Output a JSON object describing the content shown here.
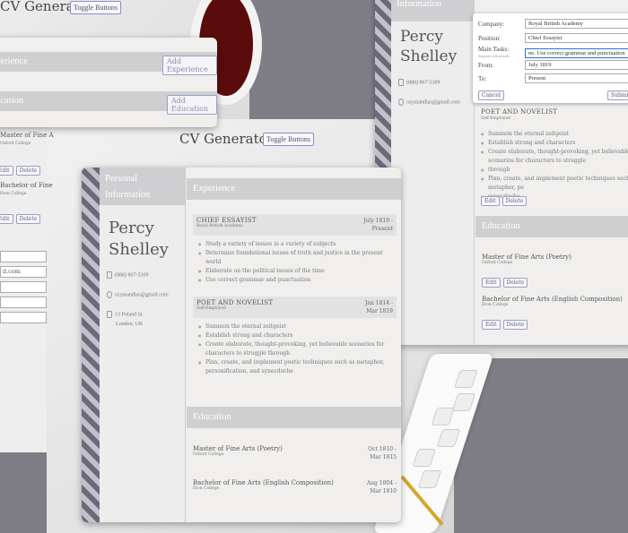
{
  "app": {
    "title": "CV Generator",
    "toggle_label": "Toggle Buttons"
  },
  "person": {
    "first_name": "Percy",
    "last_name": "Shelley",
    "phone": "(888) 867-5309",
    "email": "ozymandias@gmail.com",
    "address_line1": "13 Poland St",
    "address_line2": "London, UK",
    "personal_info_heading": "Personal Information",
    "personal_info_heading_line1": "Personal",
    "personal_info_heading_line2": "Information",
    "info_fragment": "Information"
  },
  "sections": {
    "experience": "Experience",
    "education": "Education",
    "experience_fragment": "xperience",
    "education_fragment": "ducation",
    "add_experience": "Add Experience",
    "add_education": "Add Education"
  },
  "experience": [
    {
      "title": "CHIEF ESSAYIST",
      "company": "Royal British Academy",
      "date_from": "July 1819 -",
      "date_to": "Present",
      "tasks": [
        "Study a variety of issues in a variety of subjects",
        "Determine foundational issues of truth and justice in the present world",
        "Elaborate on the political issues of the time",
        "Use correct grammar and punctuation"
      ]
    },
    {
      "title": "POET AND NOVELIST",
      "company": "Self-Employed",
      "date_from": "Jan 1814 -",
      "date_to": "Mar 1819",
      "tasks": [
        "Summon the eternal zeitgeist",
        "Establish strong and characters",
        "Create elaborate, thought-provoking, yet believable scenarios for characters to struggle through",
        "Plan, create, and implement poetic techniques such as metaphor, personification, and synecdoche"
      ],
      "right_tasks": [
        "Summon the eternal zeitgeist",
        "Establish strong and characters",
        "Create elaborate, thought-provoking, yet believable scenarios for characters to struggle",
        "through",
        "Plan, create, and implement poetic techniques such as metaphor, pe",
        "synecdoche"
      ]
    }
  ],
  "education": [
    {
      "degree": "Master of Fine Arts (Poetry)",
      "school": "Oxford College",
      "date_from": "Oct 1810 -",
      "date_to": "Mar 1815",
      "left_fragment": "Master of Fine A",
      "left_school": "Oxford College"
    },
    {
      "degree": "Bachelor of Fine Arts (English Composition)",
      "school": "Eton College",
      "date_from": "Aug 1804 -",
      "date_to": "Mar 1810",
      "left_fragment": "Bachelor of Fine",
      "left_school": "Eton College"
    }
  ],
  "buttons": {
    "edit": "Edit",
    "delete": "Delete",
    "cancel": "Cancel",
    "submit": "Submi"
  },
  "form": {
    "company_label": "Company:",
    "company_value": "Royal British Academy",
    "position_label": "Position:",
    "position_value": "Chief Essayist",
    "tasks_label": "Main Tasks:",
    "tasks_hint": "Separate with periods",
    "tasks_value": "ne.  Use correct grammar and punctuation",
    "from_label": "From:",
    "from_value": "July 1819",
    "to_label": "To:",
    "to_value": "Present"
  },
  "left_inputs": [
    "",
    "il.com",
    "",
    "",
    ""
  ],
  "colors": {
    "stripe_dark": "#6b6a7a",
    "stripe_light": "#c2c1ca",
    "header_band": "#cfcfd2",
    "button_border": "#9aa0c4",
    "focus_border": "#2673cc"
  }
}
